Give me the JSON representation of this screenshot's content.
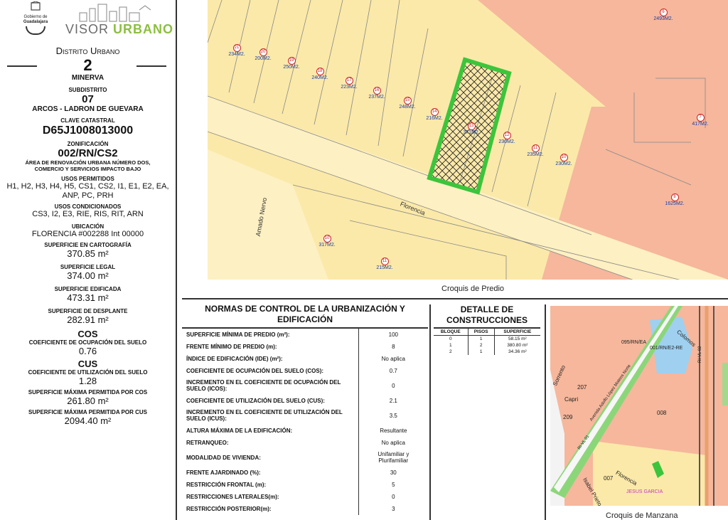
{
  "logos": {
    "seal_line1": "Gobierno de",
    "seal_line2": "Guadalajara",
    "visor_part1": "VISOR ",
    "visor_part2": "URBANO"
  },
  "district": {
    "title": "Distrito Urbano",
    "number": "2",
    "name": "MINERVA"
  },
  "subdistrict": {
    "label": "SUBDISTRITO",
    "number": "07",
    "name": "ARCOS - LADRON DE GUEVARA"
  },
  "clave": {
    "label": "CLAVE CATASTRAL",
    "value": "D65J1008013000"
  },
  "zonificacion": {
    "label": "ZONIFICACIÓN",
    "value": "002/RN/CS2",
    "desc1": "ÁREA DE RENOVACIÓN URBANA NÚMERO DOS,",
    "desc2": "COMERCIO Y SERVICIOS IMPACTO BAJO"
  },
  "usos_permitidos": {
    "label": "USOS PERMITIDOS",
    "line1": "H1, H2, H3, H4, H5, CS1, CS2, I1, E1, E2, EA,",
    "line2": "ANP, PC, PRH"
  },
  "usos_condicionados": {
    "label": "USOS CONDICIONADOS",
    "value": "CS3, I2, E3, RIE, RIS, RIT, ARN"
  },
  "ubicacion": {
    "label": "UBICACIÓN",
    "value": "FLORENCIA #002288 Int 00000"
  },
  "sup_cartografia": {
    "label": "SUPERFICIE EN CARTOGRAFÍA",
    "value": "370.85 m²"
  },
  "sup_legal": {
    "label": "SUPERFICIE LEGAL",
    "value": "374.00 m²"
  },
  "sup_edificada": {
    "label": "SUPERFICIE EDIFICADA",
    "value": "473.31 m²"
  },
  "sup_desplante": {
    "label": "SUPERFICIE DE DESPLANTE",
    "value": "282.91 m²"
  },
  "cos": {
    "title": "COS",
    "label": "COEFICIENTE DE OCUPACIÓN DEL SUELO",
    "value": "0.76"
  },
  "cus": {
    "title": "CUS",
    "label": "COEFICIENTE DE UTILIZACIÓN DEL SUELO",
    "value": "1.28"
  },
  "max_cos": {
    "label": "SUPERFICIE MÁXIMA PERMITIDA POR COS",
    "value": "261.80 m²"
  },
  "max_cus": {
    "label": "SUPERFICIE MÁXIMA PERMITIDA POR CUS",
    "value": "2094.40 m²"
  },
  "map_predio": {
    "caption": "Croquis de Predio",
    "street_florencia": "Florencia",
    "street_amado": "Amado Nervo",
    "lots": [
      {
        "n": "21",
        "area": "234M2."
      },
      {
        "n": "20",
        "area": "200M2."
      },
      {
        "n": "19",
        "area": "250M2."
      },
      {
        "n": "18",
        "area": "240M2."
      },
      {
        "n": "17",
        "area": "223M2."
      },
      {
        "n": "16",
        "area": "237M2."
      },
      {
        "n": "15",
        "area": "248M2."
      },
      {
        "n": "14",
        "area": "216M2."
      },
      {
        "n": "13",
        "area": "371M2."
      },
      {
        "n": "12",
        "area": "230M2."
      },
      {
        "n": "11",
        "area": "235M2."
      },
      {
        "n": "10",
        "area": "230M2."
      },
      {
        "n": "6",
        "area": "2493M2."
      },
      {
        "n": "7",
        "area": "417M2."
      },
      {
        "n": "8",
        "area": "1625M2."
      },
      {
        "n": "10",
        "area": "317M2."
      },
      {
        "n": "11",
        "area": "215M2."
      }
    ]
  },
  "normas": {
    "title": "NORMAS DE CONTROL DE LA URBANIZACIÓN Y EDIFICACIÓN",
    "rows": [
      {
        "label": "SUPERFICIE MÍNIMA DE PREDIO (m²):",
        "value": "100"
      },
      {
        "label": "FRENTE MÍNIMO DE PREDIO (m):",
        "value": "8"
      },
      {
        "label": "ÍNDICE DE EDIFICACIÓN (IDE) (m²):",
        "value": "No aplica"
      },
      {
        "label": "COEFICIENTE DE OCUPACIÓN DEL SUELO (COS):",
        "value": "0.7"
      },
      {
        "label": "INCREMENTO EN EL COEFICIENTE DE OCUPACIÓN DEL SUELO (ICOS):",
        "value": "0"
      },
      {
        "label": "COEFICIENTE DE UTILIZACIÓN DEL SUELO (CUS):",
        "value": "2.1"
      },
      {
        "label": "INCREMENTO EN EL COEFICIENTE DE UTILIZACIÓN DEL SUELO (ICUS):",
        "value": "3.5"
      },
      {
        "label": "ALTURA MÁXIMA DE LA EDIFICACIÓN:",
        "value": "Resultante"
      },
      {
        "label": "RETRANQUEO:",
        "value": "No aplica"
      },
      {
        "label": "MODALIDAD DE VIVIENDA:",
        "value": "Unifamiliar y Plurifamiliar"
      },
      {
        "label": "FRENTE AJARDINADO (%):",
        "value": "30"
      },
      {
        "label": "RESTRICCIÓN FRONTAL (m):",
        "value": "5"
      },
      {
        "label": "RESTRICCIONES LATERALES(m):",
        "value": "0"
      },
      {
        "label": "RESTRICCIÓN POSTERIOR(m):",
        "value": "3"
      }
    ]
  },
  "detalle": {
    "title": "DETALLE DE CONSTRUCCIONES",
    "headers": [
      "BLOQUE",
      "PISOS",
      "SUPERFICIE"
    ],
    "rows": [
      [
        "0",
        "1",
        "58.15 m²"
      ],
      [
        "1",
        "2",
        "380.80 m²"
      ],
      [
        "2",
        "1",
        "34.36 m²"
      ]
    ]
  },
  "map_manzana": {
    "caption": "Croquis de Manzana",
    "labels": [
      "095/RN/EA",
      "001/RN/E2-RE",
      "Colomos",
      "207",
      "209",
      "008",
      "007",
      "Sorrento",
      "Capri",
      "Florencia",
      "Isabel Prieto",
      "JESUS GARCIA",
      "RI-VL 01",
      "RI-VL 02",
      "Avenida Adolfo López Mateos Norte"
    ]
  },
  "colors": {
    "zone_yellow": "#fbe9a9",
    "zone_salmon": "#f6b79c",
    "highlight_green": "#3cc53c",
    "brand_green": "#8cbf3f"
  }
}
